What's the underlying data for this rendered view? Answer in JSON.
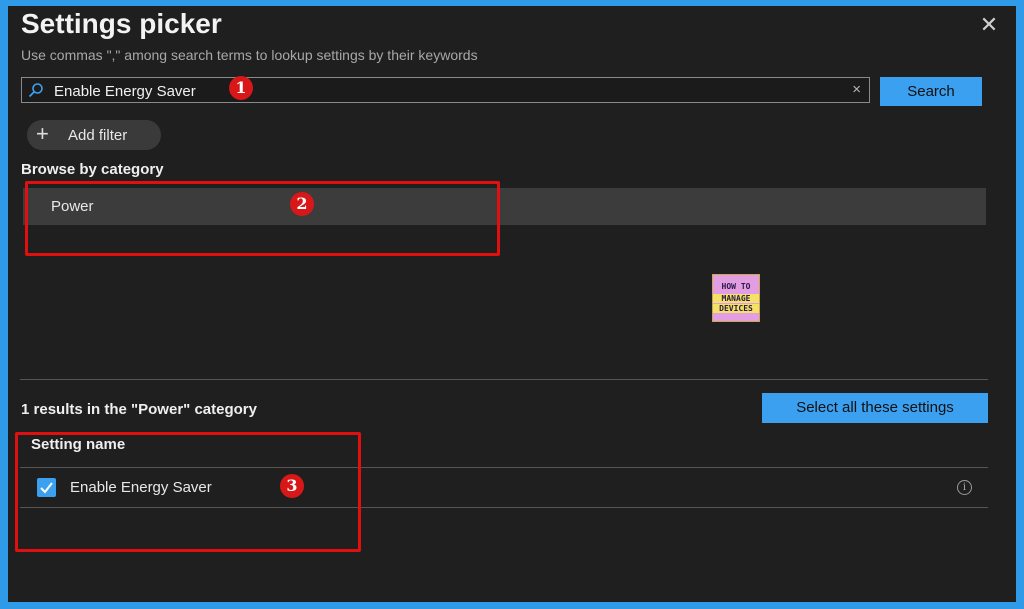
{
  "dialog": {
    "title": "Settings picker",
    "subtitle": "Use commas \",\" among search terms to lookup settings by their keywords",
    "close_glyph": "✕"
  },
  "search": {
    "value": "Enable Energy Saver",
    "placeholder": "",
    "button_label": "Search",
    "clear_glyph": "×",
    "icon": "search-icon"
  },
  "filter": {
    "add_label": "Add filter",
    "plus_glyph": "+"
  },
  "browse": {
    "heading": "Browse by category",
    "categories": [
      {
        "label": "Power"
      }
    ]
  },
  "logo": {
    "line1": "HOW TO",
    "line2": "MANAGE",
    "line3": "DEVICES"
  },
  "results": {
    "summary": "1 results in the \"Power\" category",
    "select_all_label": "Select all these settings",
    "column_header": "Setting name",
    "rows": [
      {
        "name": "Enable Energy Saver",
        "checked": true
      }
    ]
  },
  "annotations": {
    "markers": [
      "1",
      "2",
      "3"
    ],
    "color": "#e01010"
  },
  "colors": {
    "accent": "#3ba0f0",
    "background": "#1f1f1f",
    "frame": "#2f9ae8"
  }
}
